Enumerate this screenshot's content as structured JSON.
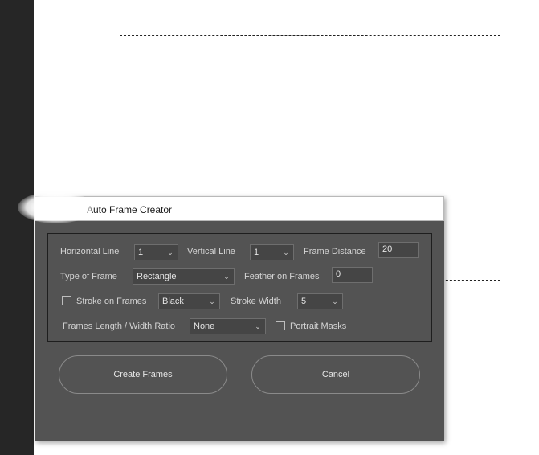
{
  "dialog": {
    "title": "Auto Frame Creator",
    "fields": {
      "horizontal_line": {
        "label": "Horizontal Line",
        "value": "1"
      },
      "vertical_line": {
        "label": "Vertical Line",
        "value": "1"
      },
      "frame_distance": {
        "label": "Frame Distance",
        "value": "20"
      },
      "type_of_frame": {
        "label": "Type of Frame",
        "value": "Rectangle"
      },
      "feather_on_frames": {
        "label": "Feather on Frames",
        "value": "0"
      },
      "stroke_on_frames": {
        "label": "Stroke on Frames",
        "checked": false
      },
      "stroke_color": {
        "value": "Black"
      },
      "stroke_width": {
        "label": "Stroke Width",
        "value": "5"
      },
      "ratio": {
        "label": "Frames Length / Width Ratio",
        "value": "None"
      },
      "portrait_masks": {
        "label": "Portrait Masks",
        "checked": false
      }
    },
    "buttons": {
      "create": "Create Frames",
      "cancel": "Cancel"
    }
  },
  "icons": {
    "dropdown": "chevron-down-icon",
    "checkbox": "checkbox-icon"
  },
  "colors": {
    "dialog_bg": "#535353",
    "app_panel": "#262626",
    "control_bg": "#454545"
  }
}
